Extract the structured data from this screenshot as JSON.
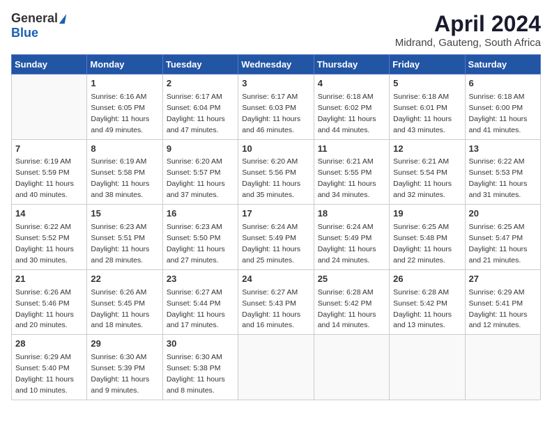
{
  "header": {
    "logo_general": "General",
    "logo_blue": "Blue",
    "month": "April 2024",
    "location": "Midrand, Gauteng, South Africa"
  },
  "weekdays": [
    "Sunday",
    "Monday",
    "Tuesday",
    "Wednesday",
    "Thursday",
    "Friday",
    "Saturday"
  ],
  "weeks": [
    [
      {
        "day": "",
        "sunrise": "",
        "sunset": "",
        "daylight": ""
      },
      {
        "day": "1",
        "sunrise": "Sunrise: 6:16 AM",
        "sunset": "Sunset: 6:05 PM",
        "daylight": "Daylight: 11 hours and 49 minutes."
      },
      {
        "day": "2",
        "sunrise": "Sunrise: 6:17 AM",
        "sunset": "Sunset: 6:04 PM",
        "daylight": "Daylight: 11 hours and 47 minutes."
      },
      {
        "day": "3",
        "sunrise": "Sunrise: 6:17 AM",
        "sunset": "Sunset: 6:03 PM",
        "daylight": "Daylight: 11 hours and 46 minutes."
      },
      {
        "day": "4",
        "sunrise": "Sunrise: 6:18 AM",
        "sunset": "Sunset: 6:02 PM",
        "daylight": "Daylight: 11 hours and 44 minutes."
      },
      {
        "day": "5",
        "sunrise": "Sunrise: 6:18 AM",
        "sunset": "Sunset: 6:01 PM",
        "daylight": "Daylight: 11 hours and 43 minutes."
      },
      {
        "day": "6",
        "sunrise": "Sunrise: 6:18 AM",
        "sunset": "Sunset: 6:00 PM",
        "daylight": "Daylight: 11 hours and 41 minutes."
      }
    ],
    [
      {
        "day": "7",
        "sunrise": "Sunrise: 6:19 AM",
        "sunset": "Sunset: 5:59 PM",
        "daylight": "Daylight: 11 hours and 40 minutes."
      },
      {
        "day": "8",
        "sunrise": "Sunrise: 6:19 AM",
        "sunset": "Sunset: 5:58 PM",
        "daylight": "Daylight: 11 hours and 38 minutes."
      },
      {
        "day": "9",
        "sunrise": "Sunrise: 6:20 AM",
        "sunset": "Sunset: 5:57 PM",
        "daylight": "Daylight: 11 hours and 37 minutes."
      },
      {
        "day": "10",
        "sunrise": "Sunrise: 6:20 AM",
        "sunset": "Sunset: 5:56 PM",
        "daylight": "Daylight: 11 hours and 35 minutes."
      },
      {
        "day": "11",
        "sunrise": "Sunrise: 6:21 AM",
        "sunset": "Sunset: 5:55 PM",
        "daylight": "Daylight: 11 hours and 34 minutes."
      },
      {
        "day": "12",
        "sunrise": "Sunrise: 6:21 AM",
        "sunset": "Sunset: 5:54 PM",
        "daylight": "Daylight: 11 hours and 32 minutes."
      },
      {
        "day": "13",
        "sunrise": "Sunrise: 6:22 AM",
        "sunset": "Sunset: 5:53 PM",
        "daylight": "Daylight: 11 hours and 31 minutes."
      }
    ],
    [
      {
        "day": "14",
        "sunrise": "Sunrise: 6:22 AM",
        "sunset": "Sunset: 5:52 PM",
        "daylight": "Daylight: 11 hours and 30 minutes."
      },
      {
        "day": "15",
        "sunrise": "Sunrise: 6:23 AM",
        "sunset": "Sunset: 5:51 PM",
        "daylight": "Daylight: 11 hours and 28 minutes."
      },
      {
        "day": "16",
        "sunrise": "Sunrise: 6:23 AM",
        "sunset": "Sunset: 5:50 PM",
        "daylight": "Daylight: 11 hours and 27 minutes."
      },
      {
        "day": "17",
        "sunrise": "Sunrise: 6:24 AM",
        "sunset": "Sunset: 5:49 PM",
        "daylight": "Daylight: 11 hours and 25 minutes."
      },
      {
        "day": "18",
        "sunrise": "Sunrise: 6:24 AM",
        "sunset": "Sunset: 5:49 PM",
        "daylight": "Daylight: 11 hours and 24 minutes."
      },
      {
        "day": "19",
        "sunrise": "Sunrise: 6:25 AM",
        "sunset": "Sunset: 5:48 PM",
        "daylight": "Daylight: 11 hours and 22 minutes."
      },
      {
        "day": "20",
        "sunrise": "Sunrise: 6:25 AM",
        "sunset": "Sunset: 5:47 PM",
        "daylight": "Daylight: 11 hours and 21 minutes."
      }
    ],
    [
      {
        "day": "21",
        "sunrise": "Sunrise: 6:26 AM",
        "sunset": "Sunset: 5:46 PM",
        "daylight": "Daylight: 11 hours and 20 minutes."
      },
      {
        "day": "22",
        "sunrise": "Sunrise: 6:26 AM",
        "sunset": "Sunset: 5:45 PM",
        "daylight": "Daylight: 11 hours and 18 minutes."
      },
      {
        "day": "23",
        "sunrise": "Sunrise: 6:27 AM",
        "sunset": "Sunset: 5:44 PM",
        "daylight": "Daylight: 11 hours and 17 minutes."
      },
      {
        "day": "24",
        "sunrise": "Sunrise: 6:27 AM",
        "sunset": "Sunset: 5:43 PM",
        "daylight": "Daylight: 11 hours and 16 minutes."
      },
      {
        "day": "25",
        "sunrise": "Sunrise: 6:28 AM",
        "sunset": "Sunset: 5:42 PM",
        "daylight": "Daylight: 11 hours and 14 minutes."
      },
      {
        "day": "26",
        "sunrise": "Sunrise: 6:28 AM",
        "sunset": "Sunset: 5:42 PM",
        "daylight": "Daylight: 11 hours and 13 minutes."
      },
      {
        "day": "27",
        "sunrise": "Sunrise: 6:29 AM",
        "sunset": "Sunset: 5:41 PM",
        "daylight": "Daylight: 11 hours and 12 minutes."
      }
    ],
    [
      {
        "day": "28",
        "sunrise": "Sunrise: 6:29 AM",
        "sunset": "Sunset: 5:40 PM",
        "daylight": "Daylight: 11 hours and 10 minutes."
      },
      {
        "day": "29",
        "sunrise": "Sunrise: 6:30 AM",
        "sunset": "Sunset: 5:39 PM",
        "daylight": "Daylight: 11 hours and 9 minutes."
      },
      {
        "day": "30",
        "sunrise": "Sunrise: 6:30 AM",
        "sunset": "Sunset: 5:38 PM",
        "daylight": "Daylight: 11 hours and 8 minutes."
      },
      {
        "day": "",
        "sunrise": "",
        "sunset": "",
        "daylight": ""
      },
      {
        "day": "",
        "sunrise": "",
        "sunset": "",
        "daylight": ""
      },
      {
        "day": "",
        "sunrise": "",
        "sunset": "",
        "daylight": ""
      },
      {
        "day": "",
        "sunrise": "",
        "sunset": "",
        "daylight": ""
      }
    ]
  ]
}
